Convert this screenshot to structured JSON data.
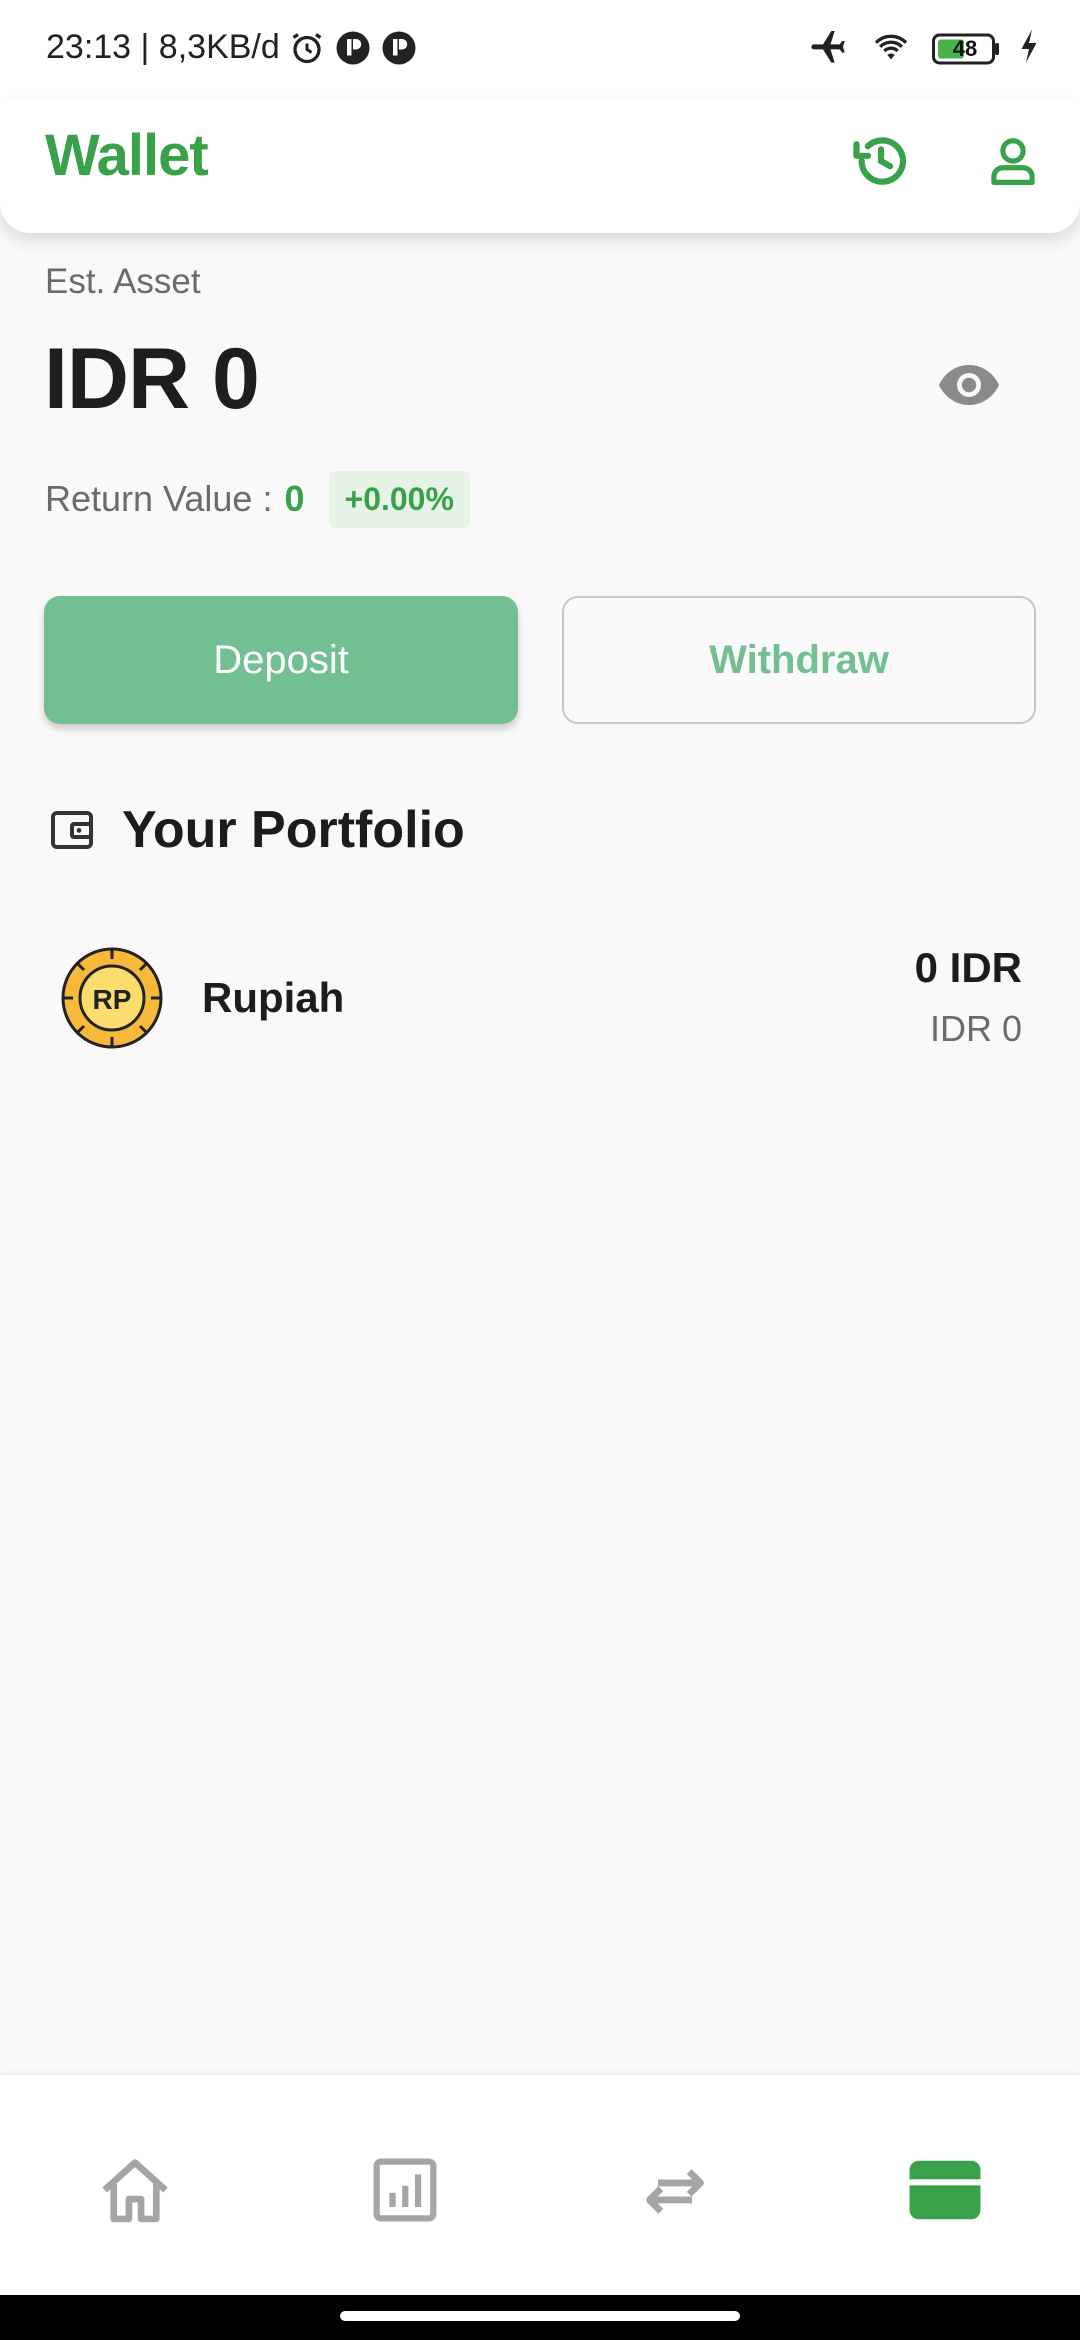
{
  "status_bar": {
    "time_speed": "23:13 | 8,3KB/d",
    "battery": "48"
  },
  "header": {
    "title": "Wallet"
  },
  "asset": {
    "label": "Est. Asset",
    "value": "IDR 0",
    "return_label": "Return Value :",
    "return_amount": "0",
    "return_percent": "+0.00%"
  },
  "actions": {
    "deposit": "Deposit",
    "withdraw": "Withdraw"
  },
  "portfolio": {
    "title": "Your Portfolio",
    "items": [
      {
        "name": "Rupiah",
        "amount": "0 IDR",
        "value": "IDR 0",
        "icon": "rupiah-coin-icon",
        "coin_symbol": "RP"
      }
    ]
  },
  "nav": {
    "items": [
      "home-icon",
      "chart-icon",
      "exchange-icon",
      "wallet-icon"
    ],
    "active_index": 3
  },
  "colors": {
    "brand_green": "#38a14a",
    "button_green": "#72bf92",
    "badge_bg": "#e6f3e6"
  }
}
